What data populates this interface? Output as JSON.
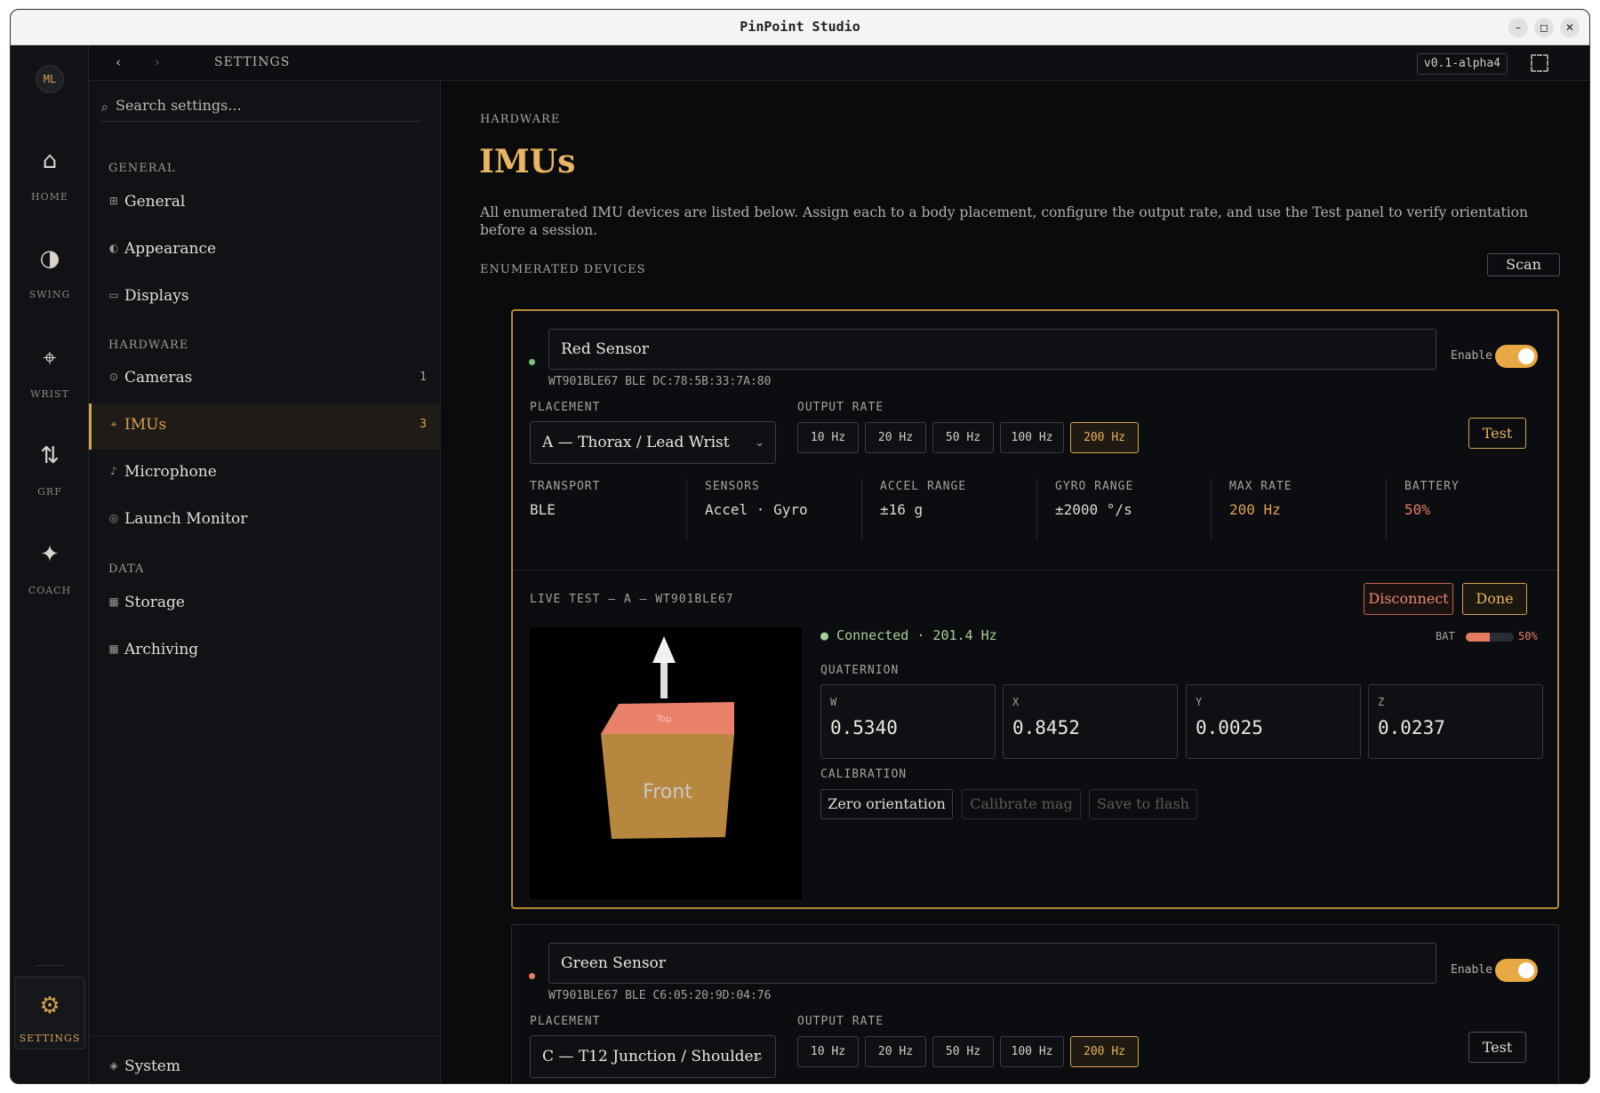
{
  "window": {
    "title": "PinPoint Studio",
    "minimize": "–",
    "maximize": "◻",
    "close": "✕"
  },
  "rail": {
    "avatar": "ML",
    "items": [
      {
        "icon": "⌂",
        "label": "HOME"
      },
      {
        "icon": "◑",
        "label": "SWING"
      },
      {
        "icon": "⌖",
        "label": "WRIST"
      },
      {
        "icon": "⇅",
        "label": "GRF"
      },
      {
        "icon": "✦",
        "label": "COACH"
      }
    ],
    "settings": {
      "icon": "⚙",
      "label": "SETTINGS"
    }
  },
  "topnav": {
    "back": "‹",
    "forward": "›",
    "breadcrumb": "SETTINGS",
    "version": "v0.1-alpha4"
  },
  "sidebar": {
    "search_placeholder": "Search settings...",
    "search_icon": "⌕",
    "sections": [
      {
        "title": "GENERAL",
        "items": [
          {
            "icon": "⊞",
            "label": "General",
            "count": ""
          },
          {
            "icon": "◐",
            "label": "Appearance",
            "count": ""
          },
          {
            "icon": "▭",
            "label": "Displays",
            "count": ""
          }
        ]
      },
      {
        "title": "HARDWARE",
        "items": [
          {
            "icon": "⊙",
            "label": "Cameras",
            "count": "1"
          },
          {
            "icon": "⌖",
            "label": "IMUs",
            "count": "3"
          },
          {
            "icon": "♪",
            "label": "Microphone",
            "count": ""
          },
          {
            "icon": "◎",
            "label": "Launch Monitor",
            "count": ""
          }
        ]
      },
      {
        "title": "DATA",
        "items": [
          {
            "icon": "▦",
            "label": "Storage",
            "count": ""
          },
          {
            "icon": "▦",
            "label": "Archiving",
            "count": ""
          }
        ]
      }
    ],
    "system": {
      "icon": "◈",
      "label": "System"
    }
  },
  "main": {
    "section": "HARDWARE",
    "title": "IMUs",
    "description": "All enumerated IMU devices are listed below. Assign each to a body placement, configure the output rate, and use the Test panel to verify orientation before a session.",
    "devices_header": "ENUMERATED DEVICES",
    "scan_label": "Scan",
    "labels": {
      "enable": "Enable",
      "placement": "PLACEMENT",
      "output_rate": "OUTPUT RATE",
      "test": "Test"
    },
    "rates": [
      "10 Hz",
      "20 Hz",
      "50 Hz",
      "100 Hz",
      "200 Hz"
    ],
    "devices": [
      {
        "name": "Red Sensor",
        "meta": "WT901BLE67  BLE  DC:78:5B:33:7A:80",
        "status_color": "#7fc27a",
        "enabled": true,
        "placement": "A — Thorax / Lead Wrist",
        "selected_rate": "200 Hz",
        "stats": [
          {
            "key": "TRANSPORT",
            "value": "BLE"
          },
          {
            "key": "SENSORS",
            "value": "Accel · Gyro"
          },
          {
            "key": "ACCEL RANGE",
            "value": "±16 g"
          },
          {
            "key": "GYRO RANGE",
            "value": "±2000 °/s"
          },
          {
            "key": "MAX RATE",
            "value": "200 Hz"
          },
          {
            "key": "BATTERY",
            "value": "50%"
          }
        ],
        "live_test": {
          "header": "LIVE TEST — A — WT901BLE67",
          "disconnect": "Disconnect",
          "done": "Done",
          "status": "● Connected · 201.4 Hz",
          "battery_label": "BAT",
          "battery_value": "50%",
          "battery_fraction": 0.5,
          "cube_front": "Front",
          "cube_top": "Top",
          "quaternion_label": "QUATERNION",
          "quaternion": [
            {
              "k": "W",
              "v": "0.5340"
            },
            {
              "k": "X",
              "v": "0.8452"
            },
            {
              "k": "Y",
              "v": "0.0025"
            },
            {
              "k": "Z",
              "v": "0.0237"
            }
          ],
          "calibration_label": "CALIBRATION",
          "calibration": [
            "Zero orientation",
            "Calibrate mag",
            "Save to flash"
          ]
        }
      },
      {
        "name": "Green Sensor",
        "meta": "WT901BLE67  BLE  C6:05:20:9D:04:76",
        "status_color": "#e77b62",
        "enabled": true,
        "placement": "C — T12 Junction / Shoulder",
        "selected_rate": "200 Hz"
      }
    ]
  },
  "colors": {
    "accent": "#d6a253",
    "danger": "#e77b62",
    "ok": "#7fc27a"
  }
}
